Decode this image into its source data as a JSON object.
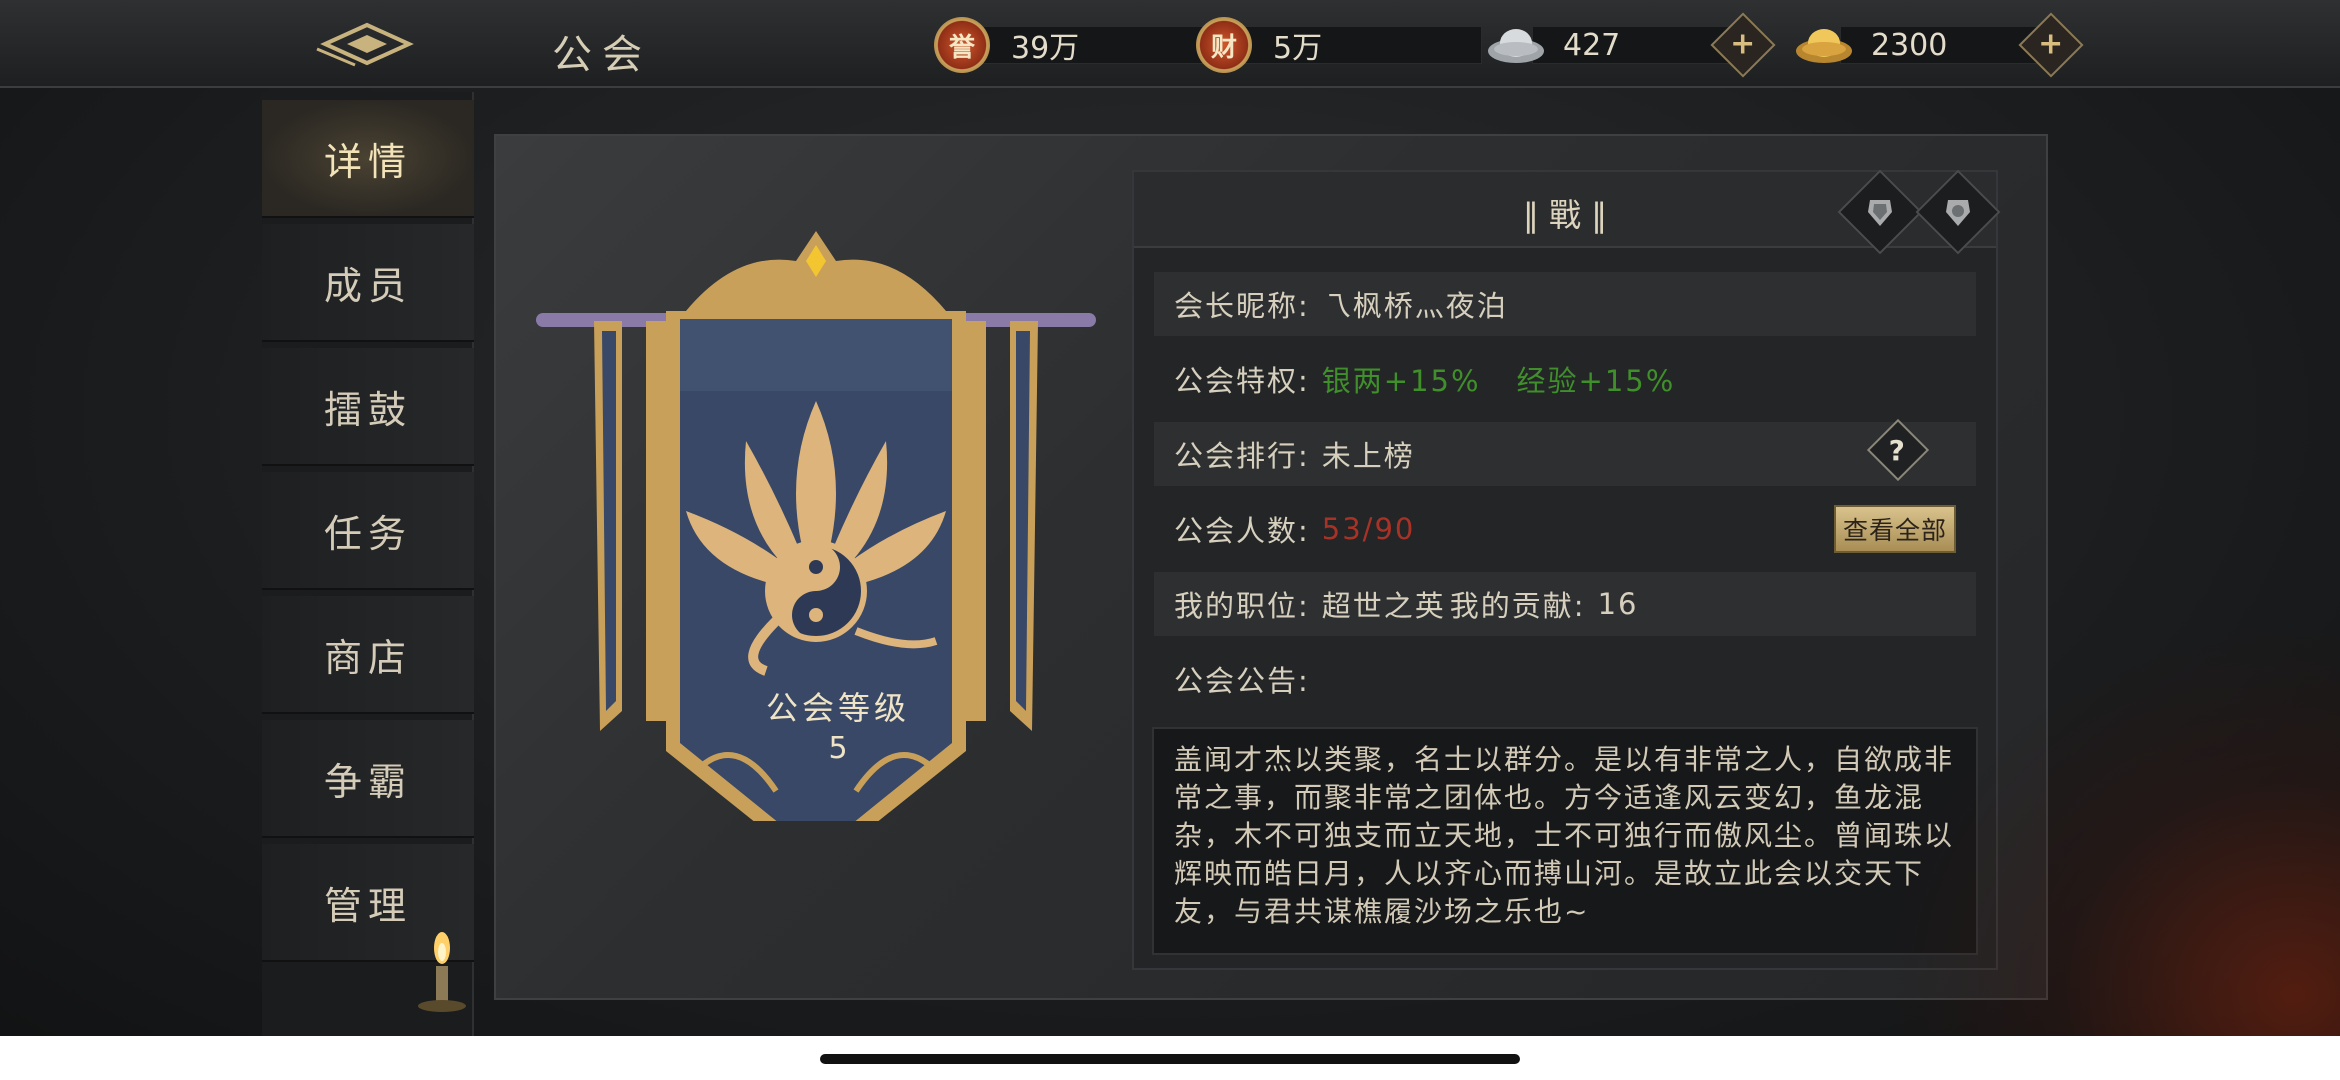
{
  "header": {
    "title": "公会",
    "currencies": [
      {
        "name": "honor",
        "value": "39万",
        "icon_label": "誉",
        "color": "#b84a2a"
      },
      {
        "name": "wealth",
        "value": "5万",
        "icon_label": "财",
        "color": "#b84a2a"
      },
      {
        "name": "silver",
        "value": "427"
      },
      {
        "name": "gold-ingot",
        "value": "2300"
      }
    ]
  },
  "sidebar": {
    "items": [
      {
        "label": "详情",
        "active": true
      },
      {
        "label": "成员"
      },
      {
        "label": "擂鼓"
      },
      {
        "label": "任务"
      },
      {
        "label": "商店"
      },
      {
        "label": "争霸"
      },
      {
        "label": "管理"
      }
    ]
  },
  "banner": {
    "title": "公会等级",
    "level": "5",
    "flag_color": "#394866",
    "trim_color": "#c9a05a"
  },
  "guild": {
    "name": "‖ 戰 ‖",
    "leader_label": "会长昵称:",
    "leader_value": "乁枫桥灬夜泊",
    "privilege_label": "公会特权:",
    "privilege_1": "银两+15%",
    "privilege_2": "经验+15%",
    "rank_label": "公会排行:",
    "rank_value": "未上榜",
    "help_label": "?",
    "members_label": "公会人数:",
    "members_value": "53/90",
    "view_all_label": "查看全部",
    "position_label": "我的职位:",
    "position_value": "超世之英",
    "contribution_label": "我的贡献:",
    "contribution_value": "16",
    "notice_label": "公会公告:",
    "notice_text": "盖闻才杰以类聚，名士以群分。是以有非常之人，自欲成非常之事，而聚非常之团体也。方今适逢风云变幻，鱼龙混杂，木不可独支而立天地，士不可独行而傲风尘。曾闻珠以辉映而皓日月，人以齐心而搏山河。是故立此会以交天下友，与君共谋樵履沙场之乐也~"
  }
}
